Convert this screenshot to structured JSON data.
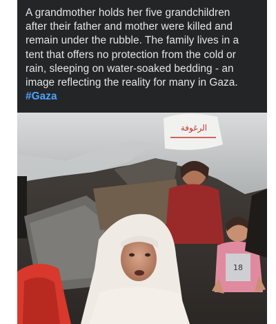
{
  "post": {
    "caption": "A grandmother holds her five grandchildren\nafter their father and mother were killed and\nremain under the rubble. The family lives in a\ntent that offers no protection from the cold or\nrain, sleeping on water-soaked bedding - an\nimage reflecting the reality for many in Gaza.",
    "hashtag": "#Gaza"
  },
  "media": {
    "bag_print": "الرغوفة"
  },
  "colors": {
    "card_background": "#242526",
    "text": "#e4e6eb",
    "hashtag": "#4da3ff"
  }
}
